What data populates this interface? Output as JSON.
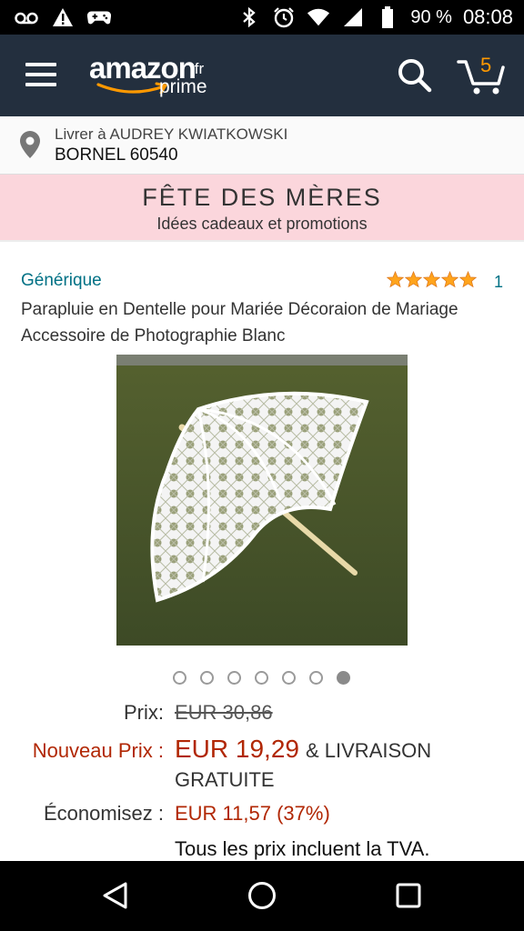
{
  "status_bar": {
    "icons_left": [
      "voicemail-icon",
      "warning-icon",
      "gamepad-icon"
    ],
    "icons_right": [
      "bluetooth-icon",
      "alarm-icon",
      "wifi-icon",
      "signal-icon",
      "battery-icon"
    ],
    "battery": "90 %",
    "time": "08:08"
  },
  "header": {
    "logo_main": "amazon",
    "logo_tld": ".fr",
    "logo_prime": "prime",
    "cart_count": "5",
    "colors": {
      "background": "#232f3e",
      "accent": "#ff9900"
    }
  },
  "delivery": {
    "line1": "Livrer à AUDREY KWIATKOWSKI",
    "line2": "BORNEL 60540"
  },
  "banner": {
    "title": "FÊTE DES MÈRES",
    "subtitle": "Idées cadeaux et promotions",
    "background": "#fbd6dc"
  },
  "product": {
    "brand": "Générique",
    "rating_stars": 5,
    "rating_count": "1",
    "title": "Parapluie en Dentelle pour Mariée Décoraion de Mariage Accessoire de Photographie Blanc",
    "image_count": 7,
    "active_image": 7
  },
  "pricing": {
    "price_label": "Prix:",
    "old_price": "EUR 30,86",
    "new_label": "Nouveau Prix :",
    "new_price": "EUR 19,29",
    "shipping_part1": "& LIVRAISON",
    "shipping_part2": "GRATUITE",
    "save_label": "Économisez :",
    "save_value": "EUR 11,57 (37%)",
    "vat_note": "Tous les prix incluent la TVA.",
    "price_color": "#b12704"
  },
  "nav_bar": {
    "buttons": [
      "back-icon",
      "home-icon",
      "recent-apps-icon"
    ]
  }
}
